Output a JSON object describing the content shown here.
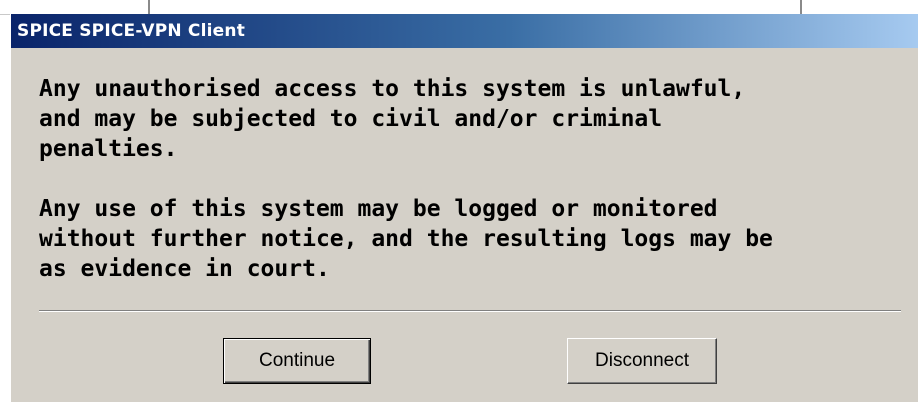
{
  "dialog": {
    "title": "SPICE SPICE-VPN Client",
    "message": {
      "paragraph1": [
        "Any unauthorised access to this system is unlawful,",
        "and may be subjected to civil and/or criminal",
        "penalties."
      ],
      "paragraph2": [
        "Any use of this system may be logged or monitored",
        "without further notice, and the resulting logs may be",
        "as evidence in court."
      ]
    },
    "buttons": {
      "continue_label": "Continue",
      "disconnect_label": "Disconnect"
    }
  },
  "colors": {
    "titlebar_start": "#0a246a",
    "titlebar_end": "#a6caf0",
    "dialog_face": "#d4d0c8"
  }
}
